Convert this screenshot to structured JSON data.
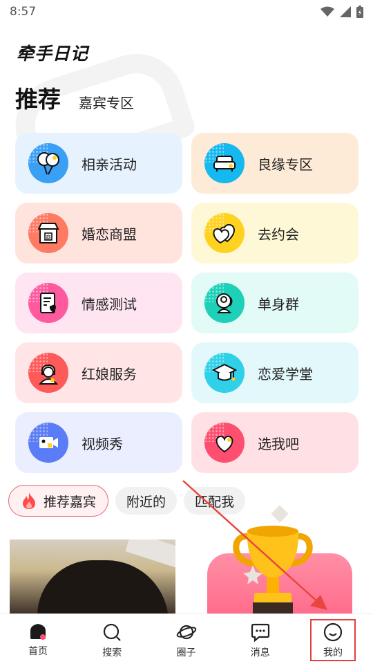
{
  "status_bar": {
    "time": "8:57"
  },
  "header": {
    "app_logo": "牵手日记"
  },
  "section": {
    "title": "推荐",
    "subtitle": "嘉宾专区"
  },
  "grid_items": [
    {
      "label": "相亲活动",
      "icon": "balloons-icon",
      "bg": "#e6f3ff",
      "icon_bg": "#3aa0f6"
    },
    {
      "label": "良缘专区",
      "icon": "sofa-icon",
      "bg": "#fdebd7",
      "icon_bg": "#16b8f0"
    },
    {
      "label": "婚恋商盟",
      "icon": "shop-icon",
      "bg": "#ffe4de",
      "icon_bg": "#ff7a63"
    },
    {
      "label": "去约会",
      "icon": "hearts-icon",
      "bg": "#fff8d6",
      "icon_bg": "#ffd21f"
    },
    {
      "label": "情感测试",
      "icon": "quiz-icon",
      "bg": "#ffe5f1",
      "icon_bg": "#ff5aa0"
    },
    {
      "label": "单身群",
      "icon": "person-icon",
      "bg": "#e2fbf6",
      "icon_bg": "#1ed0b8"
    },
    {
      "label": "红娘服务",
      "icon": "matchmaker-icon",
      "bg": "#ffe5e5",
      "icon_bg": "#ff5a5a"
    },
    {
      "label": "恋爱学堂",
      "icon": "graduation-cap-icon",
      "bg": "#e2f8fb",
      "icon_bg": "#2fd0e8"
    },
    {
      "label": "视频秀",
      "icon": "video-camera-icon",
      "bg": "#eaeefe",
      "icon_bg": "#5a7cf6"
    },
    {
      "label": "选我吧",
      "icon": "heart-icon",
      "bg": "#ffe1e5",
      "icon_bg": "#ff4f70"
    }
  ],
  "filters": [
    {
      "label": "推荐嘉宾",
      "active": true
    },
    {
      "label": "附近的",
      "active": false
    },
    {
      "label": "匹配我",
      "active": false
    }
  ],
  "bottom_nav": [
    {
      "label": "首页",
      "icon": "home-icon"
    },
    {
      "label": "搜索",
      "icon": "search-icon"
    },
    {
      "label": "圈子",
      "icon": "planet-icon"
    },
    {
      "label": "消息",
      "icon": "chat-bubble-icon"
    },
    {
      "label": "我的",
      "icon": "smiley-icon"
    }
  ],
  "colors": {
    "accent": "#e0403f",
    "chip_active_border": "#e4727f"
  }
}
